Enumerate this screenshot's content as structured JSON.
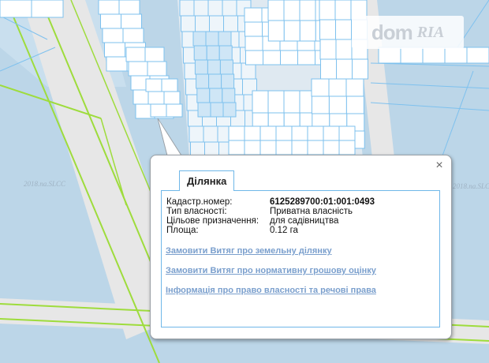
{
  "watermark": {
    "dom": "dom",
    "ria": "RIA"
  },
  "map_stamps": [
    "2018.na.SLCC",
    "2018.na.SLCC"
  ],
  "popup": {
    "tab_label": "Ділянка",
    "close_icon": "×",
    "fields": [
      {
        "label": "Кадастр.номер:",
        "value": "6125289700:01:001:0493"
      },
      {
        "label": "Тип власності:",
        "value": "Приватна власність"
      },
      {
        "label": "Цільове призначення:",
        "value": "для садівництва"
      },
      {
        "label": "Площа:",
        "value": "0.12 га"
      }
    ],
    "links": [
      "Замовити Витяг про земельну ділянку",
      "Замовити Витяг про нормативну грошову оцінку",
      "Інформація про право власності та речові права"
    ]
  },
  "colors": {
    "map_background": "#bcd6e8",
    "parcel_fill": "#ffffff",
    "parcel_stroke": "#7ec1ee",
    "road": "#e6e6e6",
    "road_line": "#9edc3c",
    "link": "#7a9fcd"
  }
}
